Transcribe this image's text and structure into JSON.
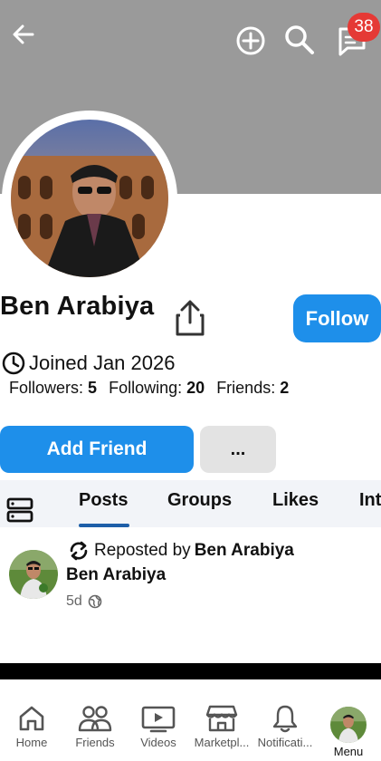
{
  "header": {
    "notification_count": "38"
  },
  "profile": {
    "name": "Ben Arabiya",
    "follow_label": "Follow",
    "joined": "Joined Jan 2026",
    "followers_label": "Followers:",
    "followers_count": "5",
    "following_label": "Following:",
    "following_count": "20",
    "friends_label": "Friends:",
    "friends_count": "2",
    "add_friend_label": "Add Friend",
    "more_label": "..."
  },
  "tabs": [
    {
      "label": "Posts",
      "active": true
    },
    {
      "label": "Groups"
    },
    {
      "label": "Likes"
    },
    {
      "label": "Int"
    }
  ],
  "post": {
    "repost_prefix": "Reposted by",
    "repost_by": "Ben Arabiya",
    "author": "Ben Arabiya",
    "time": "5d"
  },
  "bottom_nav": [
    {
      "label": "Home",
      "icon": "home-icon"
    },
    {
      "label": "Friends",
      "icon": "friends-icon"
    },
    {
      "label": "Videos",
      "icon": "videos-icon"
    },
    {
      "label": "Marketpl...",
      "icon": "marketplace-icon"
    },
    {
      "label": "Notificati...",
      "icon": "bell-icon"
    },
    {
      "label": "Menu",
      "icon": "avatar"
    }
  ],
  "colors": {
    "accent": "#1e8fea",
    "badge": "#e53935",
    "cover": "#9a9a9a"
  }
}
